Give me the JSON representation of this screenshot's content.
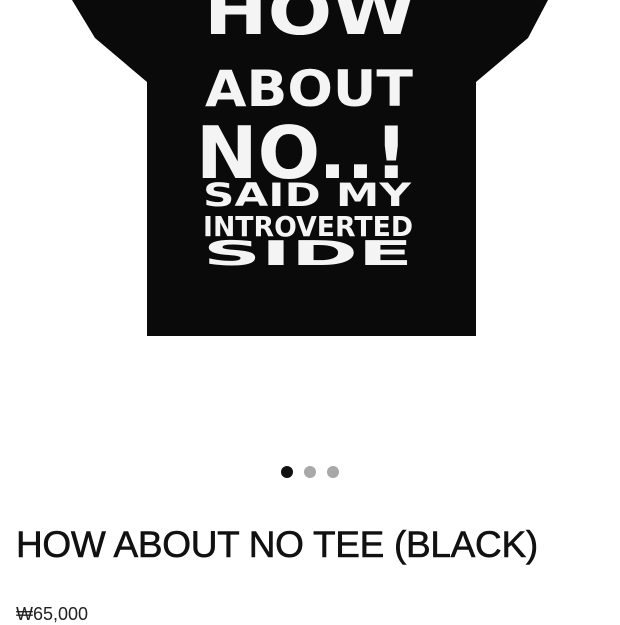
{
  "product": {
    "image": {
      "graphic_lines": [
        "HOW",
        "ABOUT",
        "NO..!",
        "SAID MY",
        "INTROVERTED",
        "SIDE"
      ],
      "shirt_color": "#0a0a0a",
      "print_color": "#f4f4f4"
    },
    "carousel": {
      "total_slides": 3,
      "active_index": 0
    },
    "title": "HOW ABOUT NO TEE (BLACK)",
    "price": "₩65,000"
  }
}
